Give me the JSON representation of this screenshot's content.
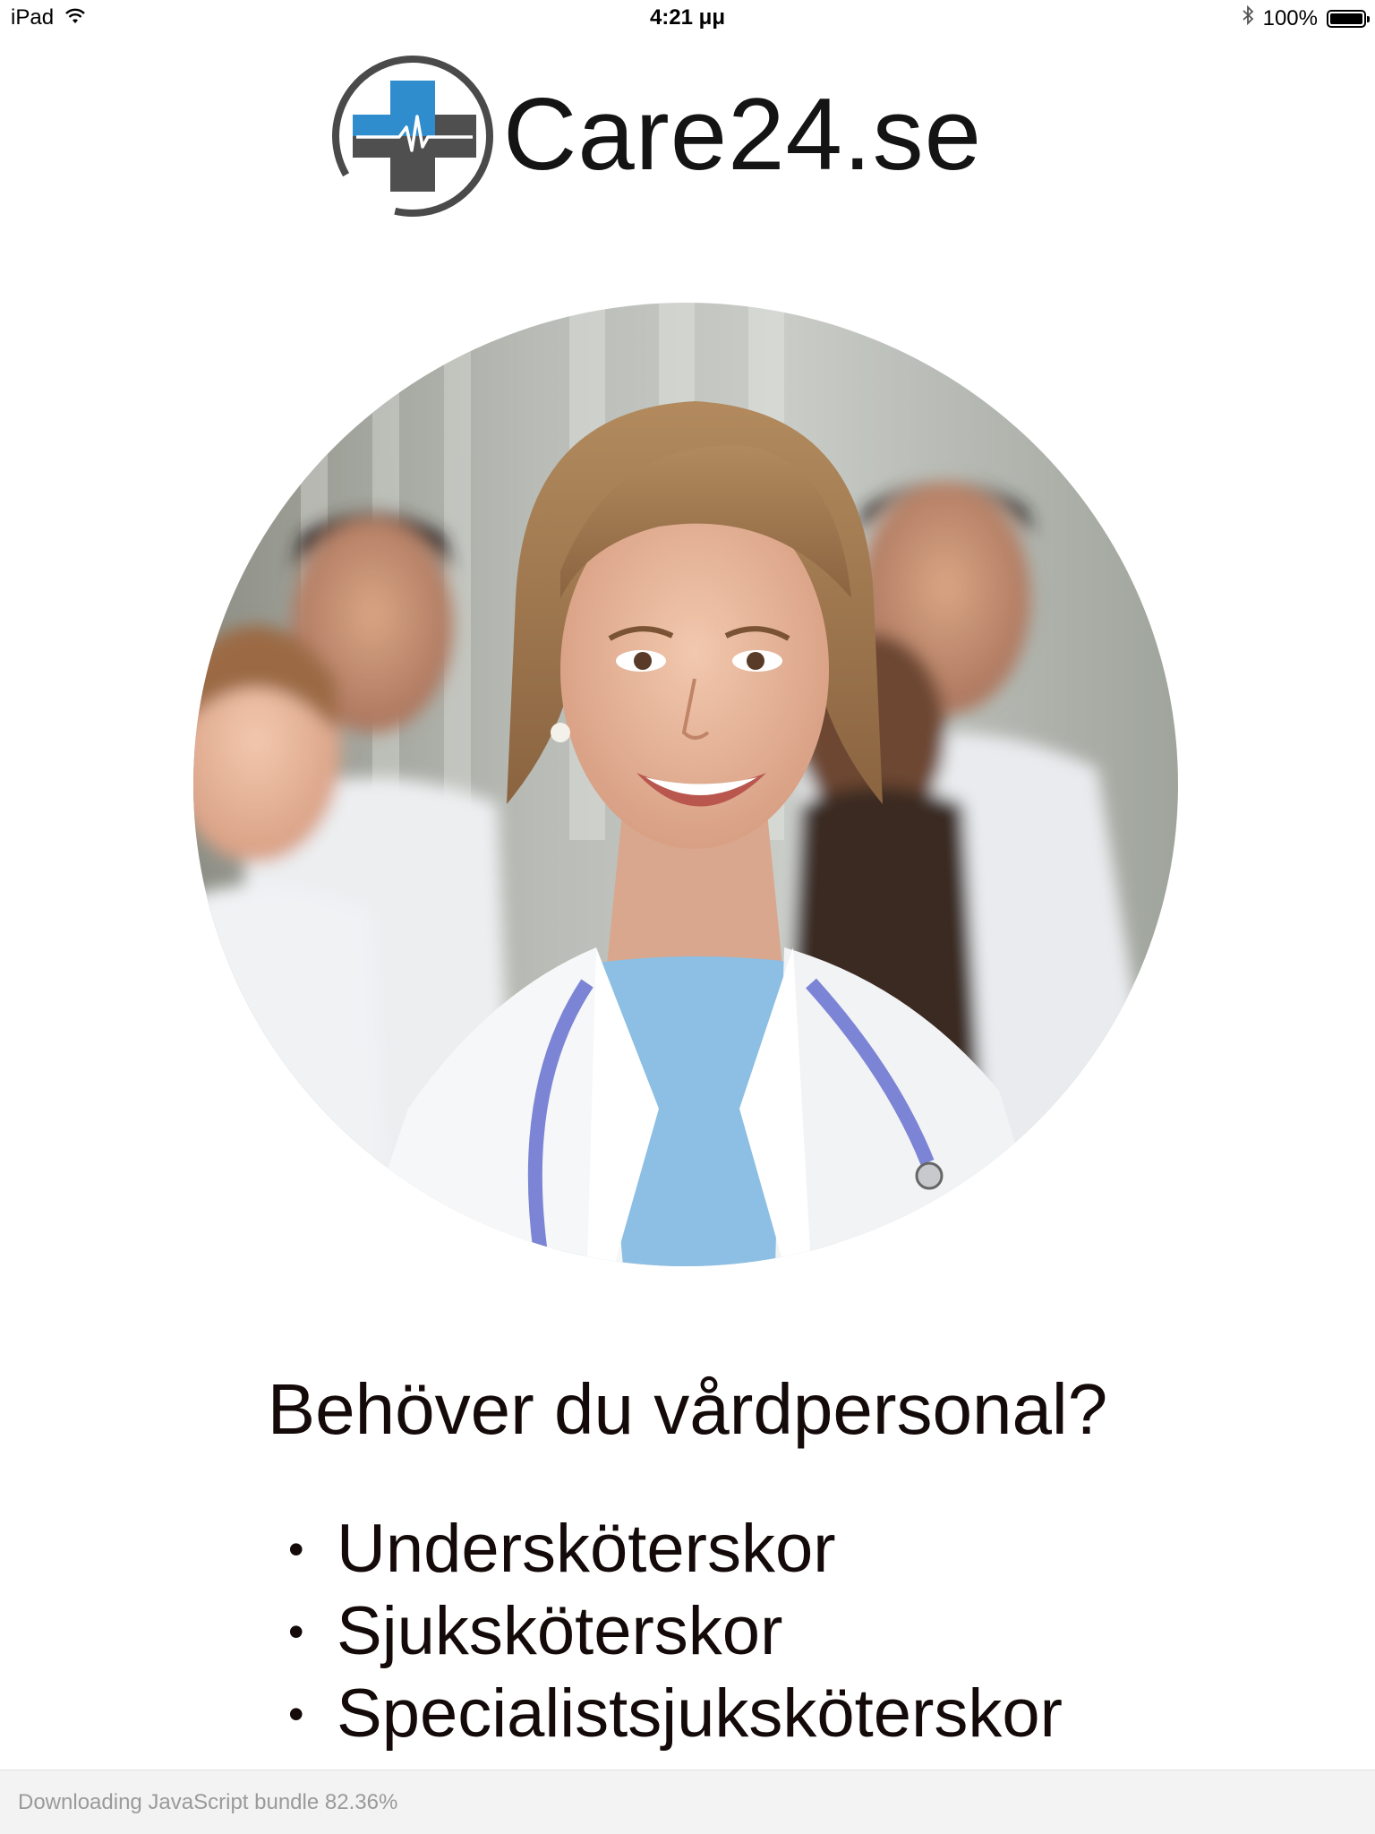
{
  "status_bar": {
    "device": "iPad",
    "time": "4:21 μμ",
    "battery": "100%",
    "battery_level": 1.0
  },
  "logo": {
    "text": "Care24.se",
    "colors": {
      "blue": "#2f8ccd",
      "gray": "#4f4f4f",
      "ring": "#4a4a4a"
    }
  },
  "hero": {
    "description_icon": "medical-staff-photo"
  },
  "headline": "Behöver du vårdpersonal?",
  "services": [
    {
      "bullet": "•",
      "label": "Undersköterskor"
    },
    {
      "bullet": "•",
      "label": "Sjuksköterskor"
    },
    {
      "bullet": "•",
      "label": "Specialistsjuksköterskor"
    }
  ],
  "bundle_banner": {
    "text": "Downloading JavaScript bundle 82.36%",
    "progress": 0.8236
  }
}
